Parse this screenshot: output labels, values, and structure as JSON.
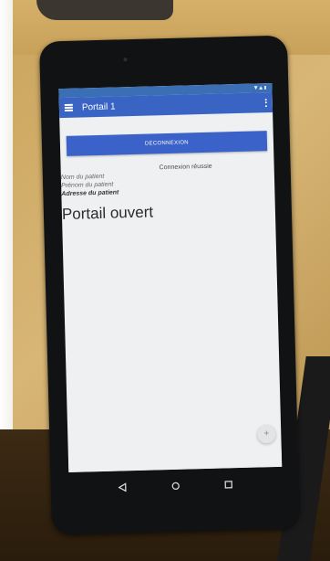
{
  "app": {
    "title": "Portail 1",
    "status_icons": "▼ ▲ ▮"
  },
  "main": {
    "logout_label": "DECONNEXION",
    "status_message": "Connexion réussie",
    "patient_name": "Nom du patient",
    "patient_firstname": "Prénom du patient",
    "patient_address": "Adresse du patient",
    "portal_status": "Portail ouvert"
  },
  "fab": {
    "label": "+"
  },
  "icons": [
    "menu-icon",
    "overflow-menu-icon",
    "back-icon",
    "home-icon",
    "recents-icon",
    "add-icon"
  ]
}
